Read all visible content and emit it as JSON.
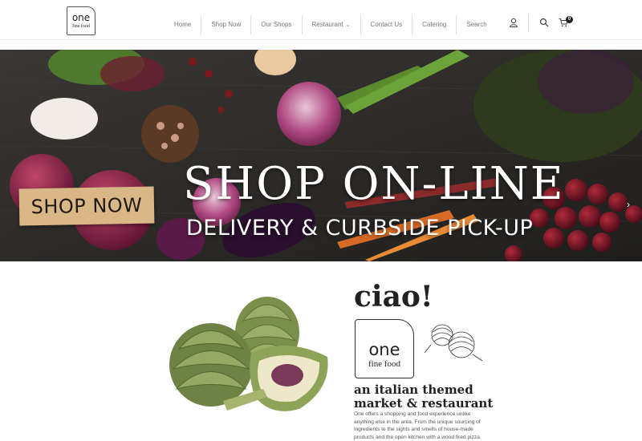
{
  "header": {
    "logo": {
      "line1": "one",
      "line2": "fine food"
    },
    "nav": [
      {
        "label": "Home"
      },
      {
        "label": "Shop Now"
      },
      {
        "label": "Our Shops"
      },
      {
        "label": "Restaurant",
        "has_dropdown": true
      },
      {
        "label": "Contact Us"
      },
      {
        "label": "Catering"
      },
      {
        "label": "Search"
      }
    ],
    "icons": [
      "user-icon",
      "search-icon",
      "cart-icon"
    ],
    "cart_count": "0"
  },
  "hero": {
    "badge": "SHOP NOW",
    "title": "SHOP ON-LINE",
    "subtitle": "DELIVERY & CURBSIDE PICK-UP",
    "arrow_icon": "chevron-right-icon"
  },
  "intro": {
    "heading": "ciao!",
    "logo": {
      "line1": "one",
      "line2": "fine food"
    },
    "tagline_line1": "an italian themed",
    "tagline_line2": "market & restaurant",
    "description": "One offers a shopping and food experience unlike anything else in the area. From the unique sourcing of ingredients to the sights and smells of house-made products and the open kitchen with a wood fired pizza oven, we are offering:"
  },
  "colors": {
    "hero_bg": "#2c2b29",
    "badge_bg": "#d9b787",
    "text_dark": "#222222",
    "nav_text": "#777777"
  }
}
